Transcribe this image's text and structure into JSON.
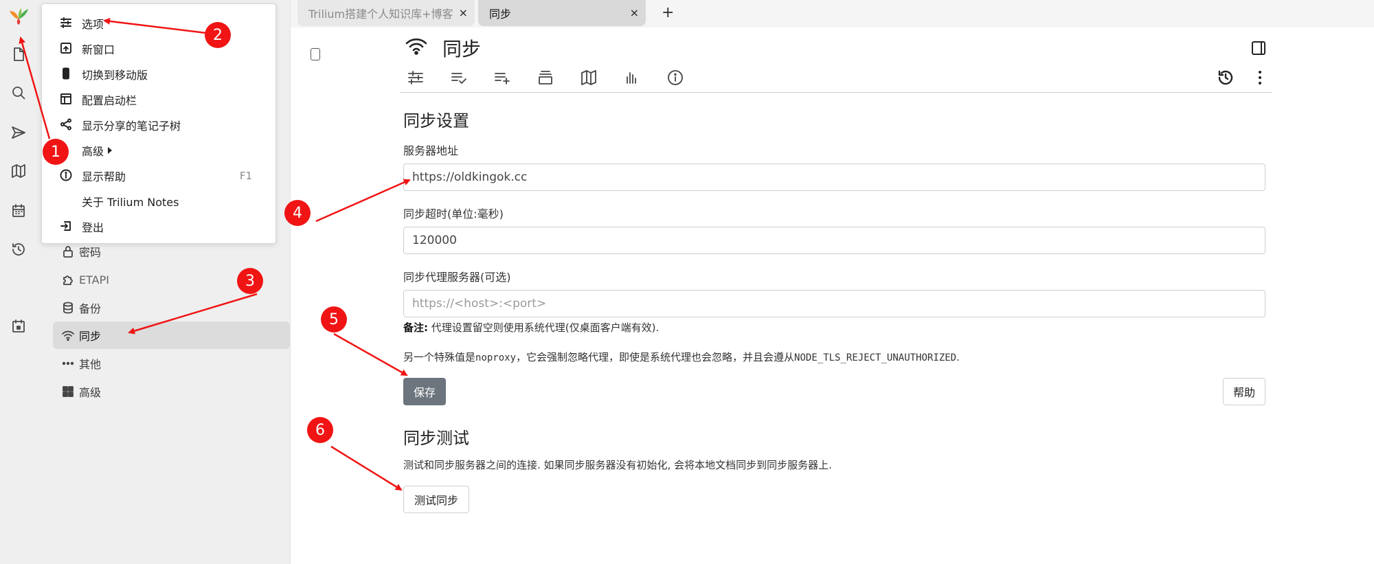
{
  "tabs": [
    {
      "title": "Trilium搭建个人知识库+博客",
      "close": "×"
    },
    {
      "title": "同步",
      "close": "×"
    }
  ],
  "new_tab": "+",
  "note": {
    "title": "同步"
  },
  "menu": {
    "items": [
      {
        "label": "选项",
        "icon": "sliders-icon"
      },
      {
        "label": "新窗口",
        "icon": "new-window-icon"
      },
      {
        "label": "切换到移动版",
        "icon": "mobile-icon"
      },
      {
        "label": "配置启动栏",
        "icon": "launchbar-icon"
      },
      {
        "label": "显示分享的笔记子树",
        "icon": "share-icon"
      },
      {
        "label": "高级",
        "icon": ""
      },
      {
        "label": "显示帮助",
        "icon": "info-icon",
        "shortcut": "F1"
      },
      {
        "label": "关于 Trilium Notes",
        "icon": ""
      },
      {
        "label": "登出",
        "icon": "logout-icon"
      }
    ]
  },
  "tree": {
    "items": [
      {
        "label": "密码",
        "icon": "lock-icon"
      },
      {
        "label": "ETAPI",
        "icon": "puzzle-icon"
      },
      {
        "label": "备份",
        "icon": "database-icon"
      },
      {
        "label": "同步",
        "icon": "wifi-icon",
        "active": true
      },
      {
        "label": "其他",
        "icon": "dots-icon"
      },
      {
        "label": "高级",
        "icon": "grid-icon"
      }
    ]
  },
  "sync_settings": {
    "heading": "同步设置",
    "server_label": "服务器地址",
    "server_value": "https://oldkingok.cc",
    "timeout_label": "同步超时(单位:毫秒)",
    "timeout_value": "120000",
    "proxy_label": "同步代理服务器(可选)",
    "proxy_placeholder": "https://<host>:<port>",
    "note_bold": "备注:",
    "note_text": " 代理设置留空则使用系统代理(仅桌面客户端有效).",
    "special_prefix": "另一个特殊值是",
    "special_noproxy": "noproxy",
    "special_middle": "，它会强制忽略代理，即使是系统代理也会忽略，并且会遵从",
    "special_env": "NODE_TLS_REJECT_UNAUTHORIZED",
    "special_suffix": ".",
    "save_label": "保存",
    "help_label": "帮助"
  },
  "sync_test": {
    "heading": "同步测试",
    "description": "测试和同步服务器之间的连接. 如果同步服务器没有初始化, 会将本地文档同步到同步服务器上.",
    "button_label": "测试同步"
  },
  "annotations": [
    "1",
    "2",
    "3",
    "4",
    "5",
    "6"
  ],
  "colors": {
    "annotation": "#f01414",
    "save_button": "#6c757d",
    "active_tree": "#dcdcdc"
  }
}
